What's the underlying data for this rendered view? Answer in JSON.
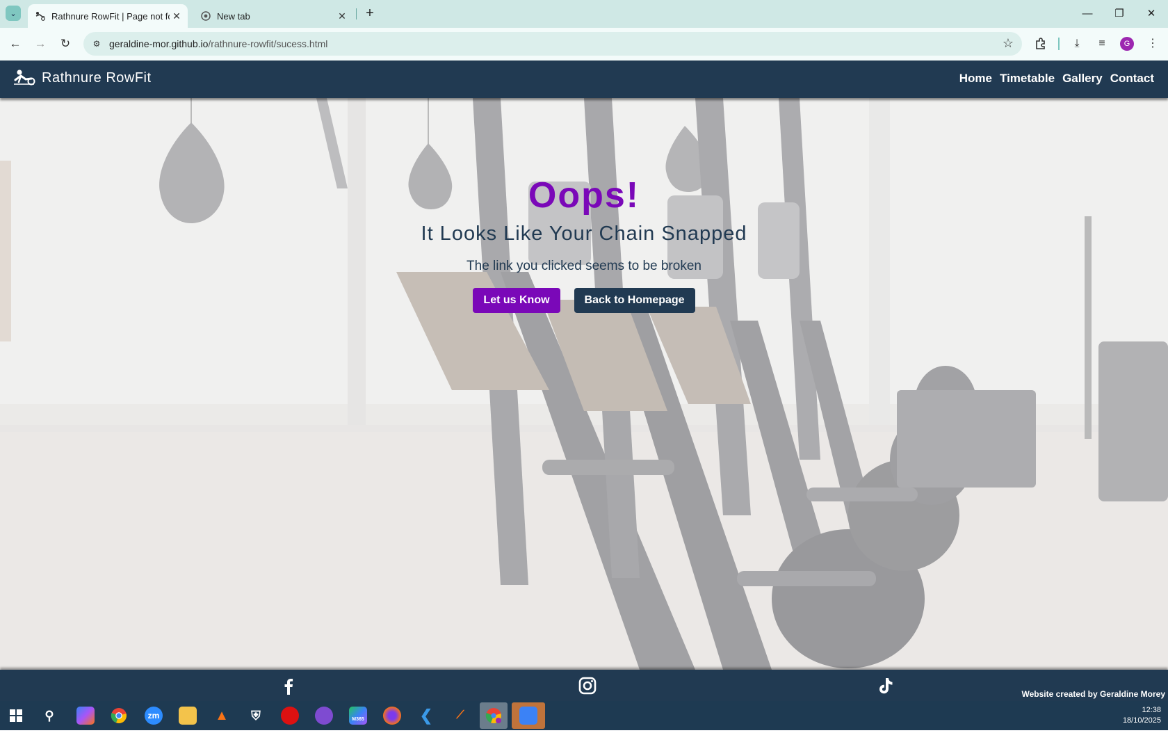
{
  "browser": {
    "tabs": [
      {
        "title": "Rathnure RowFit | Page not found",
        "close": "✕"
      },
      {
        "title": "New tab",
        "close": "✕"
      }
    ],
    "new_tab": "+",
    "url_host": "geraldine-mor.github.io",
    "url_path": "/rathnure-rowfit/sucess.html",
    "window_controls": {
      "minimize": "—",
      "restore": "❐",
      "close": "✕"
    },
    "profile_initial": "G"
  },
  "site": {
    "brand": "Rathnure RowFit",
    "nav": [
      "Home",
      "Timetable",
      "Gallery",
      "Contact"
    ],
    "heading": "Oops!",
    "subheading": "It Looks Like Your Chain Snapped",
    "message": "The link you clicked seems to be broken",
    "buttons": {
      "primary": "Let us Know",
      "secondary": "Back to Homepage"
    },
    "footer": {
      "social": [
        "facebook-icon",
        "instagram-icon",
        "tiktok-icon"
      ],
      "credit": "Website created by Geraldine Morey"
    },
    "colors": {
      "navy": "#213a52",
      "purple": "#7a08b8"
    }
  },
  "taskbar": {
    "apps": [
      "start",
      "search",
      "copilot",
      "chrome",
      "zoom",
      "file-explorer",
      "vlc",
      "security",
      "opera",
      "tor",
      "m365",
      "firefox",
      "vscode",
      "app",
      "chrome-profile",
      "photos"
    ],
    "zoom_label": "zm",
    "m365_label": "M365",
    "time": "12:38",
    "date": "18/10/2025"
  }
}
